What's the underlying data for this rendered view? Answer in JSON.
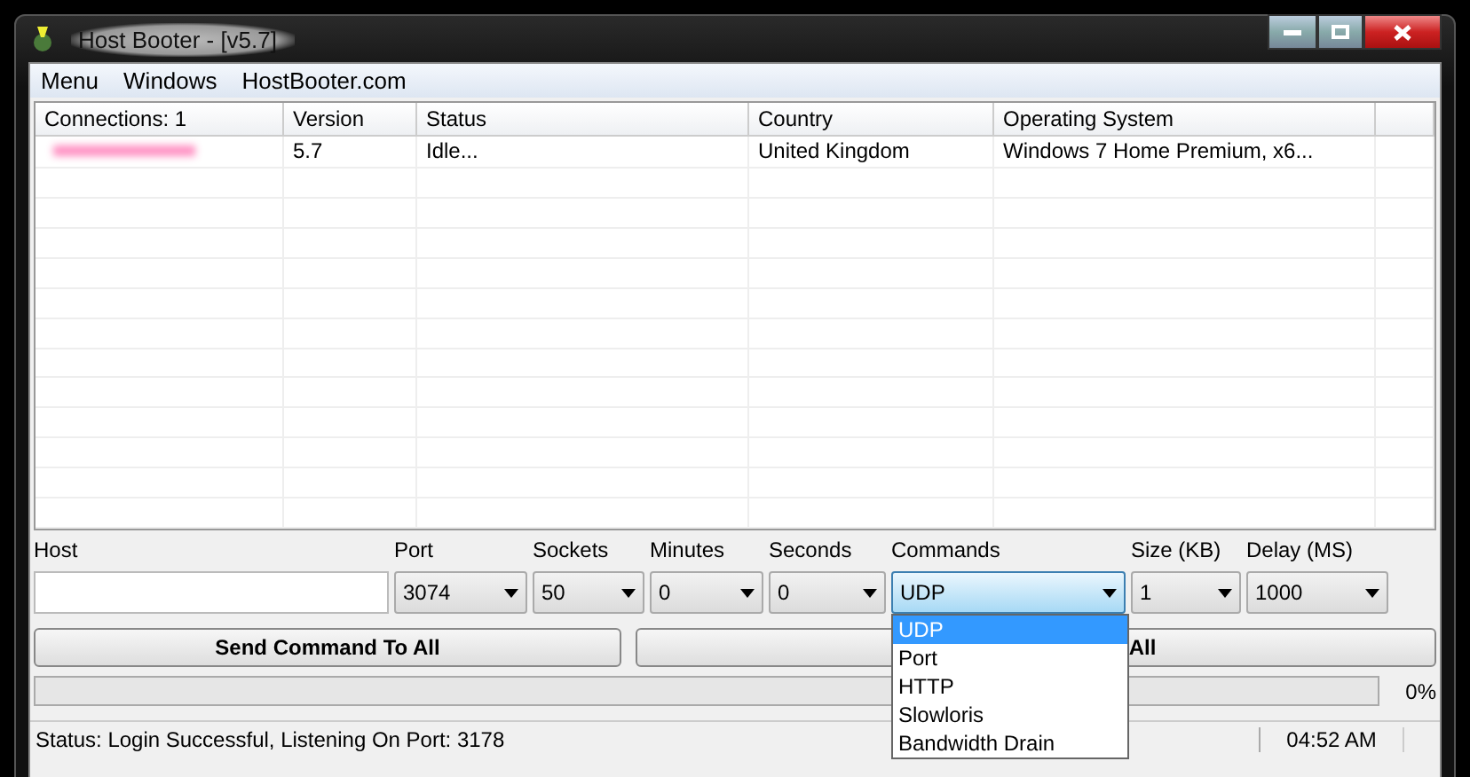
{
  "window": {
    "title": "Host Booter - [v5.7]"
  },
  "menu": [
    "Menu",
    "Windows",
    "HostBooter.com"
  ],
  "table": {
    "columns": [
      "Connections: 1",
      "Version",
      "Status",
      "Country",
      "Operating System"
    ],
    "rows": [
      {
        "redacted": true,
        "version": "5.7",
        "status": "Idle...",
        "country": "United Kingdom",
        "os": "Windows 7 Home Premium, x6..."
      }
    ]
  },
  "fields": [
    {
      "kind": "text",
      "label": "Host"
    },
    {
      "kind": "combo",
      "label": "Port",
      "value": "3074",
      "expanded": false
    },
    {
      "kind": "combo",
      "label": "Sockets",
      "value": "50",
      "expanded": false
    },
    {
      "kind": "combo",
      "label": "Minutes",
      "value": "0",
      "expanded": false
    },
    {
      "kind": "combo",
      "label": "Seconds",
      "value": "0",
      "expanded": false
    },
    {
      "kind": "combo",
      "label": "Commands",
      "value": "UDP",
      "expanded": true,
      "options": [
        {
          "label": "UDP",
          "selected": true
        },
        {
          "label": "Port",
          "selected": false
        },
        {
          "label": "HTTP",
          "selected": false
        },
        {
          "label": "Slowloris",
          "selected": false
        },
        {
          "label": "Bandwidth Drain",
          "selected": false
        }
      ]
    },
    {
      "kind": "combo",
      "label": "Size (KB)",
      "value": "1",
      "expanded": false
    },
    {
      "kind": "combo",
      "label": "Delay (MS)",
      "value": "1000",
      "expanded": false
    }
  ],
  "buttons": [
    "Send Command To All",
    "All"
  ],
  "progress": {
    "level": 0,
    "reading": "0%"
  },
  "status_bar": {
    "text": "Status: Login Successful, Listening On Port: 3178",
    "time": "04:52 AM"
  }
}
